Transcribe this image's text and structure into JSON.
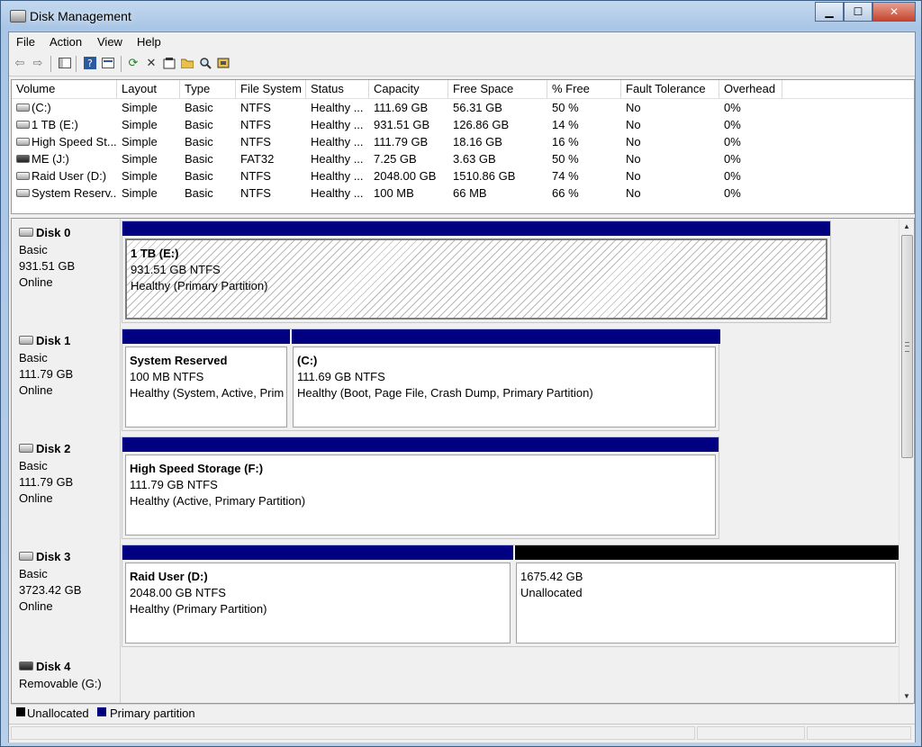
{
  "window": {
    "title": "Disk Management",
    "minimize": "▁",
    "maximize": "☐",
    "close": "✕"
  },
  "menu": [
    "File",
    "Action",
    "View",
    "Help"
  ],
  "toolbar": {
    "icons": [
      "back-icon",
      "forward-icon",
      "console-tree-icon",
      "help-icon",
      "help-topic-icon",
      "refresh-icon",
      "delete-icon",
      "properties-icon",
      "open-icon",
      "explore-icon",
      "rescan-icon"
    ]
  },
  "volume_table": {
    "columns": [
      "Volume",
      "Layout",
      "Type",
      "File System",
      "Status",
      "Capacity",
      "Free Space",
      "% Free",
      "Fault Tolerance",
      "Overhead"
    ],
    "rows": [
      {
        "volume": "(C:)",
        "layout": "Simple",
        "type": "Basic",
        "fs": "NTFS",
        "status": "Healthy ...",
        "capacity": "111.69 GB",
        "free": "56.31 GB",
        "pct": "50 %",
        "fault": "No",
        "overhead": "0%"
      },
      {
        "volume": "1 TB (E:)",
        "layout": "Simple",
        "type": "Basic",
        "fs": "NTFS",
        "status": "Healthy ...",
        "capacity": "931.51 GB",
        "free": "126.86 GB",
        "pct": "14 %",
        "fault": "No",
        "overhead": "0%"
      },
      {
        "volume": "High Speed St...",
        "layout": "Simple",
        "type": "Basic",
        "fs": "NTFS",
        "status": "Healthy ...",
        "capacity": "111.79 GB",
        "free": "18.16 GB",
        "pct": "16 %",
        "fault": "No",
        "overhead": "0%"
      },
      {
        "volume": "ME (J:)",
        "layout": "Simple",
        "type": "Basic",
        "fs": "FAT32",
        "status": "Healthy ...",
        "capacity": "7.25 GB",
        "free": "3.63 GB",
        "pct": "50 %",
        "fault": "No",
        "overhead": "0%"
      },
      {
        "volume": "Raid User (D:)",
        "layout": "Simple",
        "type": "Basic",
        "fs": "NTFS",
        "status": "Healthy ...",
        "capacity": "2048.00 GB",
        "free": "1510.86 GB",
        "pct": "74 %",
        "fault": "No",
        "overhead": "0%"
      },
      {
        "volume": "System Reserv...",
        "layout": "Simple",
        "type": "Basic",
        "fs": "NTFS",
        "status": "Healthy ...",
        "capacity": "100 MB",
        "free": "66 MB",
        "pct": "66 %",
        "fault": "No",
        "overhead": "0%"
      }
    ]
  },
  "disks": [
    {
      "name": "Disk 0",
      "type": "Basic",
      "size": "931.51 GB",
      "state": "Online",
      "partitions": [
        {
          "name": "1 TB  (E:)",
          "size": "931.51 GB NTFS",
          "status": "Healthy (Primary Partition)"
        }
      ]
    },
    {
      "name": "Disk 1",
      "type": "Basic",
      "size": "111.79 GB",
      "state": "Online",
      "partitions": [
        {
          "name": "System Reserved",
          "size": "100 MB NTFS",
          "status": "Healthy (System, Active, Prim"
        },
        {
          "name": "(C:)",
          "size": "111.69 GB NTFS",
          "status": "Healthy (Boot, Page File, Crash Dump, Primary Partition)"
        }
      ]
    },
    {
      "name": "Disk 2",
      "type": "Basic",
      "size": "111.79 GB",
      "state": "Online",
      "partitions": [
        {
          "name": "High Speed Storage  (F:)",
          "size": "111.79 GB NTFS",
          "status": "Healthy (Active, Primary Partition)"
        }
      ]
    },
    {
      "name": "Disk 3",
      "type": "Basic",
      "size": "3723.42 GB",
      "state": "Online",
      "partitions": [
        {
          "name": "Raid User  (D:)",
          "size": "2048.00 GB NTFS",
          "status": "Healthy (Primary Partition)"
        },
        {
          "name": "",
          "size": "1675.42 GB",
          "status": "Unallocated"
        }
      ]
    },
    {
      "name": "Disk 4",
      "type": "Removable (G:)"
    }
  ],
  "legend": [
    {
      "label": "Unallocated",
      "color": "#000000"
    },
    {
      "label": "Primary partition",
      "color": "#00007f"
    }
  ],
  "colors": {
    "primary": "#000080",
    "unallocated": "#000000"
  }
}
